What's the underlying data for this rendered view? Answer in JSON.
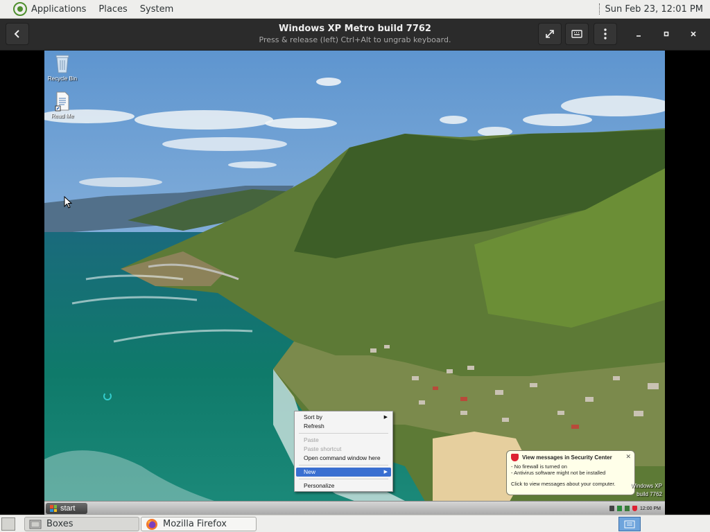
{
  "topbar": {
    "menus": [
      "Applications",
      "Places",
      "System"
    ],
    "clock": "Sun Feb 23, 12:01 PM"
  },
  "header": {
    "title": "Windows XP Metro build 7762",
    "subtitle": "Press & release (left) Ctrl+Alt to ungrab keyboard."
  },
  "desktop": {
    "icons": [
      {
        "label": "Recycle Bin",
        "icon": "recycle-bin-icon"
      },
      {
        "label": "Read Me",
        "icon": "document-shortcut-icon"
      }
    ]
  },
  "context_menu": {
    "items": [
      {
        "label": "Sort by",
        "submenu": true,
        "enabled": true
      },
      {
        "label": "Refresh",
        "enabled": true
      },
      {
        "label": "Paste",
        "enabled": false
      },
      {
        "label": "Paste shortcut",
        "enabled": false
      },
      {
        "label": "Open command window here",
        "enabled": true
      },
      {
        "label": "New",
        "submenu": true,
        "enabled": true,
        "highlighted": true
      },
      {
        "label": "Personalize",
        "enabled": true
      }
    ]
  },
  "balloon": {
    "title": "View messages in Security Center",
    "lines": [
      "- No firewall is turned on",
      "- Antivirus software might not be installed"
    ],
    "footer": "Click to view messages about your computer."
  },
  "vm_taskbar": {
    "start_label": "start",
    "clock": "12:00 PM"
  },
  "watermark": {
    "line1": "Windows XP",
    "line2": "build 7762"
  },
  "bottombar": {
    "tasks": [
      {
        "label": "Boxes",
        "icon": "boxes-icon"
      },
      {
        "label": "Mozilla Firefox",
        "icon": "firefox-icon"
      }
    ]
  },
  "colors": {
    "ctx_highlight": "#3a6fd1",
    "balloon_bg": "#ffffe9",
    "header_bg": "#2b2b2b"
  }
}
